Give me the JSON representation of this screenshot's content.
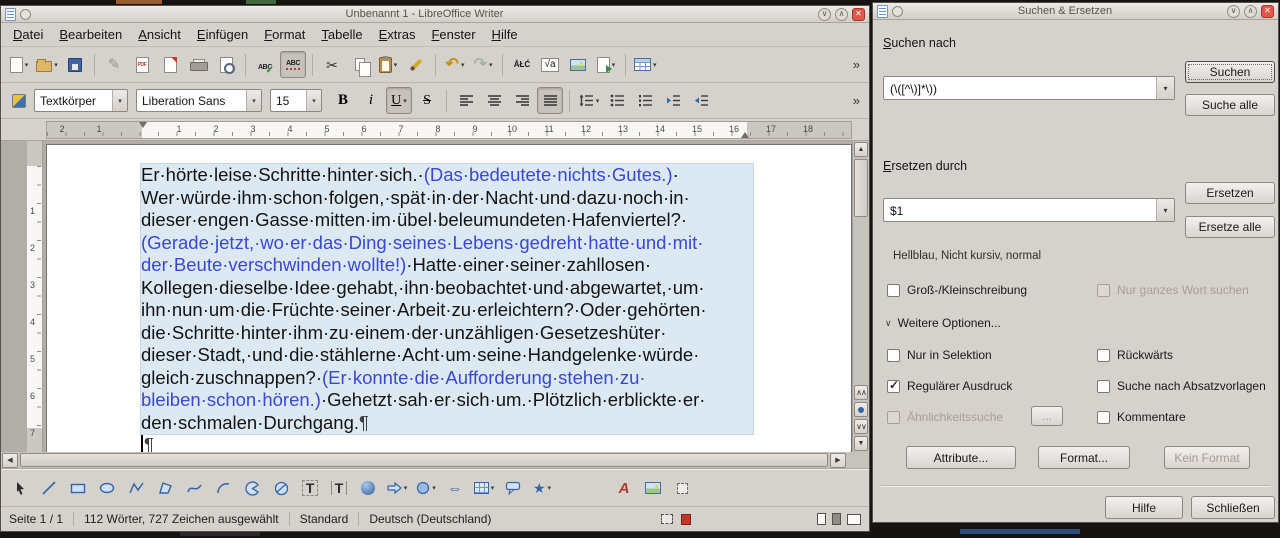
{
  "colors": {
    "match_blue": "#3a48d2",
    "selection": "#dce8f2",
    "close_red": "#e0584a"
  },
  "icons": {
    "caret": "▾",
    "check": "✓",
    "chevron_down": "∨",
    "chevron_up": "∧",
    "close": "✕",
    "overflow": "»",
    "cut": "✂",
    "undo": "↶",
    "redo": "↷",
    "pencil": "✎",
    "arrow_left": "◀",
    "arrow_right": "▶",
    "arrow_up": "▲",
    "arrow_down": "▼",
    "dbl_up": "∧∧",
    "dbl_down": "∨∨",
    "bold": "B",
    "italic": "i",
    "underline": "U",
    "strike": "S",
    "special_chars": "ÅŁĆ",
    "formula": "√a",
    "abc": "ABC",
    "pdf_label": "PDF",
    "select_arrow": "↖",
    "line": "╱",
    "double_arrow": "⇔",
    "star": "★",
    "textbox": "T",
    "vertical_text": "T",
    "fontwork_a": "A",
    "pilcrow": "¶"
  },
  "writer": {
    "title": "Unbenannt 1 - LibreOffice Writer",
    "menu": [
      "Datei",
      "Bearbeiten",
      "Ansicht",
      "Einfügen",
      "Format",
      "Tabelle",
      "Extras",
      "Fenster",
      "Hilfe"
    ],
    "format": {
      "style": "Textkörper",
      "font": "Liberation Sans",
      "size": "15"
    },
    "ruler": {
      "margin": [
        "2",
        "1"
      ],
      "numbers": [
        "1",
        "2",
        "3",
        "4",
        "5",
        "6",
        "7",
        "8",
        "9",
        "10",
        "11",
        "12",
        "13",
        "14",
        "15",
        "16",
        "17",
        "18"
      ],
      "v_numbers": [
        "1",
        "2",
        "3",
        "4",
        "5",
        "6",
        "7"
      ]
    },
    "doc": {
      "selected_lines": [
        {
          "segs": [
            {
              "t": "Er·hörte·leise·Schritte·hinter·sich.·",
              "c": "k"
            },
            {
              "t": "(Das·bedeutete·nichts·Gutes.)",
              "c": "b"
            },
            {
              "t": "·",
              "c": "k"
            }
          ]
        },
        {
          "segs": [
            {
              "t": "Wer·würde·ihm·schon·folgen,·spät·in·der·Nacht·und·dazu·noch·in·",
              "c": "k"
            }
          ]
        },
        {
          "segs": [
            {
              "t": "dieser·engen·Gasse·mitten·im·übel·beleumundeten·Hafenviertel?·",
              "c": "k"
            }
          ]
        },
        {
          "segs": [
            {
              "t": "(Gerade·jetzt,·wo·er·das·Ding·seines·Lebens·gedreht·hatte·und·mit·",
              "c": "b"
            }
          ]
        },
        {
          "segs": [
            {
              "t": "der·Beute·verschwinden·wollte!)",
              "c": "b"
            },
            {
              "t": "·Hatte·einer·seiner·zahllosen·",
              "c": "k"
            }
          ]
        },
        {
          "segs": [
            {
              "t": "Kollegen·dieselbe·Idee·gehabt,·ihn·beobachtet·und·abgewartet,·um·",
              "c": "k"
            }
          ]
        },
        {
          "segs": [
            {
              "t": "ihn·nun·um·die·Früchte·seiner·Arbeit·zu·erleichtern?·Oder·gehörten·",
              "c": "k"
            }
          ]
        },
        {
          "segs": [
            {
              "t": "die·Schritte·hinter·ihm·zu·einem·der·unzähligen·Gesetzeshüter·",
              "c": "k"
            }
          ]
        },
        {
          "segs": [
            {
              "t": "dieser·Stadt,·und·die·stählerne·Acht·um·seine·Handgelenke·würde·",
              "c": "k"
            }
          ]
        },
        {
          "segs": [
            {
              "t": "gleich·zuschnappen?·",
              "c": "k"
            },
            {
              "t": "(Er·konnte·die·Aufforderung·stehen·zu·",
              "c": "b"
            }
          ]
        },
        {
          "segs": [
            {
              "t": "bleiben·schon·hören.)",
              "c": "b"
            },
            {
              "t": "·Gehetzt·sah·er·sich·um.·Plötzlich·erblickte·er·",
              "c": "k"
            }
          ]
        },
        {
          "last": true,
          "segs": [
            {
              "t": "den·schmalen·Durchgang.",
              "c": "k"
            },
            {
              "t": "¶",
              "c": "m"
            }
          ]
        }
      ],
      "tail_lines": [
        {
          "last": true,
          "caret": true,
          "segs": [
            {
              "t": "¶",
              "c": "m"
            }
          ]
        }
      ]
    },
    "status": {
      "page": "Seite 1 / 1",
      "words": "112 Wörter, 727 Zeichen ausgewählt",
      "style": "Standard",
      "language": "Deutsch (Deutschland)"
    }
  },
  "dialog": {
    "title": "Suchen & Ersetzen",
    "search_label": "Suchen nach",
    "search_value": "(\\([^\\)]*\\))",
    "btn_search": "Suchen",
    "btn_search_all": "Suche alle",
    "replace_label": "Ersetzen durch",
    "replace_value": "$1",
    "btn_replace": "Ersetzen",
    "btn_replace_all": "Ersetze alle",
    "replace_attrs": "Hellblau, Nicht kursiv, normal",
    "cb_match_case": "Groß-/Kleinschreibung",
    "cb_whole_words": "Nur ganzes Wort suchen",
    "more_options": "Weitere Optionen...",
    "cb_selection": "Nur in Selektion",
    "cb_backwards": "Rückwärts",
    "cb_regex": "Regulärer Ausdruck",
    "cb_styles": "Suche nach Absatzvorlagen",
    "cb_similarity": "Ähnlichkeitssuche",
    "btn_similarity": "...",
    "cb_comments": "Kommentare",
    "btn_attributes": "Attribute...",
    "btn_format": "Format...",
    "btn_no_format": "Kein Format",
    "btn_help": "Hilfe",
    "btn_close": "Schließen"
  }
}
